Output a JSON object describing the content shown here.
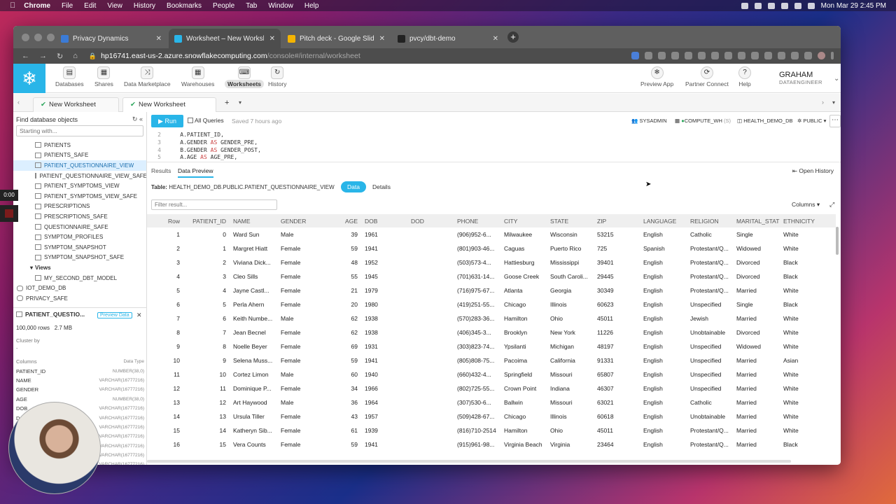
{
  "menubar": {
    "app": "Chrome",
    "items": [
      "File",
      "Edit",
      "View",
      "History",
      "Bookmarks",
      "People",
      "Tab",
      "Window",
      "Help"
    ],
    "clock": "Mon Mar 29  2:45 PM"
  },
  "browser": {
    "tabs": [
      {
        "title": "Privacy Dynamics",
        "color": "#3b7bd6"
      },
      {
        "title": "Worksheet – New Worksheet |",
        "color": "#29b5e8"
      },
      {
        "title": "Pitch deck - Google Slides",
        "color": "#f4b400"
      },
      {
        "title": "pvcy/dbt-demo",
        "color": "#222222"
      }
    ],
    "url_host": "hp16741.east-us-2.azure.snowflakecomputing.com",
    "url_path": "/console#/internal/worksheet"
  },
  "appbar": {
    "nav": [
      {
        "label": "Databases",
        "icon": "database-icon"
      },
      {
        "label": "Shares",
        "icon": "share-icon"
      },
      {
        "label": "Data Marketplace",
        "icon": "marketplace-icon"
      },
      {
        "label": "Warehouses",
        "icon": "warehouse-icon"
      },
      {
        "label": "Worksheets",
        "icon": "worksheet-icon"
      },
      {
        "label": "History",
        "icon": "history-icon"
      }
    ],
    "right": [
      {
        "label": "Preview App"
      },
      {
        "label": "Partner Connect"
      },
      {
        "label": "Help"
      }
    ],
    "user": {
      "name": "GRAHAM",
      "role": "DATAENGINEER"
    }
  },
  "worksheet_tabs": [
    "New Worksheet",
    "New Worksheet"
  ],
  "sidebar": {
    "title": "Find database objects",
    "search_placeholder": "Starting with...",
    "tree": [
      {
        "label": "PATIENTS",
        "kind": "table"
      },
      {
        "label": "PATIENTS_SAFE",
        "kind": "table"
      },
      {
        "label": "PATIENT_QUESTIONNAIRE_VIEW",
        "kind": "table",
        "selected": true
      },
      {
        "label": "PATIENT_QUESTIONNAIRE_VIEW_SAFE",
        "kind": "table"
      },
      {
        "label": "PATIENT_SYMPTOMS_VIEW",
        "kind": "table"
      },
      {
        "label": "PATIENT_SYMPTOMS_VIEW_SAFE",
        "kind": "table"
      },
      {
        "label": "PRESCRIPTIONS",
        "kind": "table"
      },
      {
        "label": "PRESCRIPTIONS_SAFE",
        "kind": "table"
      },
      {
        "label": "QUESTIONNAIRE_SAFE",
        "kind": "table"
      },
      {
        "label": "SYMPTOM_PROFILES",
        "kind": "table"
      },
      {
        "label": "SYMPTOM_SNAPSHOT",
        "kind": "table"
      },
      {
        "label": "SYMPTOM_SNAPSHOT_SAFE",
        "kind": "table"
      },
      {
        "label": "Views",
        "kind": "folder"
      },
      {
        "label": "MY_SECOND_DBT_MODEL",
        "kind": "table"
      },
      {
        "label": "IOT_DEMO_DB",
        "kind": "db"
      },
      {
        "label": "PRIVACY_SAFE",
        "kind": "db"
      }
    ],
    "object": {
      "name": "PATIENT_QUESTIO...",
      "preview_label": "Preview Data",
      "rows": "100,000 rows",
      "size": "2.7 MB",
      "cluster_label": "Cluster by",
      "cluster_value": "-",
      "columns_header": "Columns",
      "type_header": "Data Type",
      "columns": [
        {
          "name": "PATIENT_ID",
          "type": "NUMBER(38,0)"
        },
        {
          "name": "NAME",
          "type": "VARCHAR(16777216)"
        },
        {
          "name": "GENDER",
          "type": "VARCHAR(16777216)"
        },
        {
          "name": "AGE",
          "type": "NUMBER(38,0)"
        },
        {
          "name": "DOB",
          "type": "VARCHAR(16777216)"
        },
        {
          "name": "D",
          "type": "VARCHAR(16777216)"
        },
        {
          "name": "",
          "type": "VARCHAR(16777216)"
        },
        {
          "name": "",
          "type": "VARCHAR(16777216)"
        },
        {
          "name": "",
          "type": "VARCHAR(16777216)"
        },
        {
          "name": "",
          "type": "VARCHAR(16777216)"
        },
        {
          "name": "",
          "type": "VARCHAR(16777216)"
        },
        {
          "name": "",
          "type": "VARCHAR(16777216)"
        }
      ]
    }
  },
  "toolbar": {
    "run": "Run",
    "all_queries": "All Queries",
    "saved": "Saved 7 hours ago",
    "role": "SYSADMIN",
    "warehouse": "COMPUTE_WH",
    "warehouse_size": "(S)",
    "database": "HEALTH_DEMO_DB",
    "schema": "PUBLIC"
  },
  "editor": {
    "lines": [
      {
        "n": "2",
        "code": "    A.PATIENT_ID,"
      },
      {
        "n": "3",
        "code": "    A.GENDER AS GENDER_PRE,"
      },
      {
        "n": "4",
        "code": "    B.GENDER AS GENDER_POST,"
      },
      {
        "n": "5",
        "code": "    A.AGE AS AGE_PRE,"
      },
      {
        "n": "6",
        "code": "    B.AGE AS AGE_POST,"
      }
    ]
  },
  "results": {
    "tab_results": "Results",
    "tab_preview": "Data Preview",
    "open_history": "Open History",
    "table_label": "Table:",
    "table_name": "HEALTH_DEMO_DB.PUBLIC.PATIENT_QUESTIONNAIRE_VIEW",
    "toggle_data": "Data",
    "toggle_details": "Details",
    "filter_placeholder": "Filter result...",
    "columns_btn": "Columns",
    "headers": [
      "Row",
      "PATIENT_ID",
      "NAME",
      "GENDER",
      "AGE",
      "DOB",
      "DOD",
      "PHONE",
      "CITY",
      "STATE",
      "ZIP",
      "LANGUAGE",
      "RELIGION",
      "MARITAL_STATU",
      "ETHNICITY"
    ],
    "rows": [
      [
        "1",
        "0",
        "Ward Sun",
        "Male",
        "39",
        "1961",
        "",
        "(906)952-6...",
        "Milwaukee",
        "Wisconsin",
        "53215",
        "English",
        "Catholic",
        "Single",
        "White"
      ],
      [
        "2",
        "1",
        "Margret Hiatt",
        "Female",
        "59",
        "1941",
        "",
        "(801)903-46...",
        "Caguas",
        "Puerto Rico",
        "725",
        "Spanish",
        "Protestant/Q...",
        "Widowed",
        "White"
      ],
      [
        "3",
        "2",
        "Viviana Dick...",
        "Female",
        "48",
        "1952",
        "",
        "(503)573-4...",
        "Hattiesburg",
        "Mississippi",
        "39401",
        "English",
        "Protestant/Q...",
        "Divorced",
        "Black"
      ],
      [
        "4",
        "3",
        "Cleo Sills",
        "Female",
        "55",
        "1945",
        "",
        "(701)631-14...",
        "Goose Creek",
        "South Caroli...",
        "29445",
        "English",
        "Protestant/Q...",
        "Divorced",
        "Black"
      ],
      [
        "5",
        "4",
        "Jayne Castl...",
        "Female",
        "21",
        "1979",
        "",
        "(716)975-67...",
        "Atlanta",
        "Georgia",
        "30349",
        "English",
        "Protestant/Q...",
        "Married",
        "White"
      ],
      [
        "6",
        "5",
        "Perla Ahern",
        "Female",
        "20",
        "1980",
        "",
        "(419)251-55...",
        "Chicago",
        "Illinois",
        "60623",
        "English",
        "Unspecified",
        "Single",
        "Black"
      ],
      [
        "7",
        "6",
        "Keith Numbe...",
        "Male",
        "62",
        "1938",
        "",
        "(570)283-36...",
        "Hamilton",
        "Ohio",
        "45011",
        "English",
        "Jewish",
        "Married",
        "White"
      ],
      [
        "8",
        "7",
        "Jean Becnel",
        "Female",
        "62",
        "1938",
        "",
        "(406)345-3...",
        "Brooklyn",
        "New York",
        "11226",
        "English",
        "Unobtainable",
        "Divorced",
        "White"
      ],
      [
        "9",
        "8",
        "Noelle Beyer",
        "Female",
        "69",
        "1931",
        "",
        "(303)823-74...",
        "Ypsilanti",
        "Michigan",
        "48197",
        "English",
        "Unspecified",
        "Widowed",
        "White"
      ],
      [
        "10",
        "9",
        "Selena Muss...",
        "Female",
        "59",
        "1941",
        "",
        "(805)808-75...",
        "Pacoima",
        "California",
        "91331",
        "English",
        "Unspecified",
        "Married",
        "Asian"
      ],
      [
        "11",
        "10",
        "Cortez Limon",
        "Male",
        "60",
        "1940",
        "",
        "(660)432-4...",
        "Springfield",
        "Missouri",
        "65807",
        "English",
        "Unspecified",
        "Married",
        "White"
      ],
      [
        "12",
        "11",
        "Dominique P...",
        "Female",
        "34",
        "1966",
        "",
        "(802)725-55...",
        "Crown Point",
        "Indiana",
        "46307",
        "English",
        "Unspecified",
        "Married",
        "White"
      ],
      [
        "13",
        "12",
        "Art Haywood",
        "Male",
        "36",
        "1964",
        "",
        "(307)530-6...",
        "Ballwin",
        "Missouri",
        "63021",
        "English",
        "Catholic",
        "Married",
        "White"
      ],
      [
        "14",
        "13",
        "Ursula Tiller",
        "Female",
        "43",
        "1957",
        "",
        "(509)428-67...",
        "Chicago",
        "Illinois",
        "60618",
        "English",
        "Unobtainable",
        "Married",
        "White"
      ],
      [
        "15",
        "14",
        "Katheryn Sib...",
        "Female",
        "61",
        "1939",
        "",
        "(816)710-2514",
        "Hamilton",
        "Ohio",
        "45011",
        "English",
        "Protestant/Q...",
        "Married",
        "White"
      ],
      [
        "16",
        "15",
        "Vera Counts",
        "Female",
        "59",
        "1941",
        "",
        "(915)961-98...",
        "Virginia Beach",
        "Virginia",
        "23464",
        "English",
        "Protestant/Q...",
        "Married",
        "Black"
      ]
    ]
  },
  "recording": {
    "timer": "0:00"
  },
  "colors": {
    "accent": "#29b5e8"
  }
}
